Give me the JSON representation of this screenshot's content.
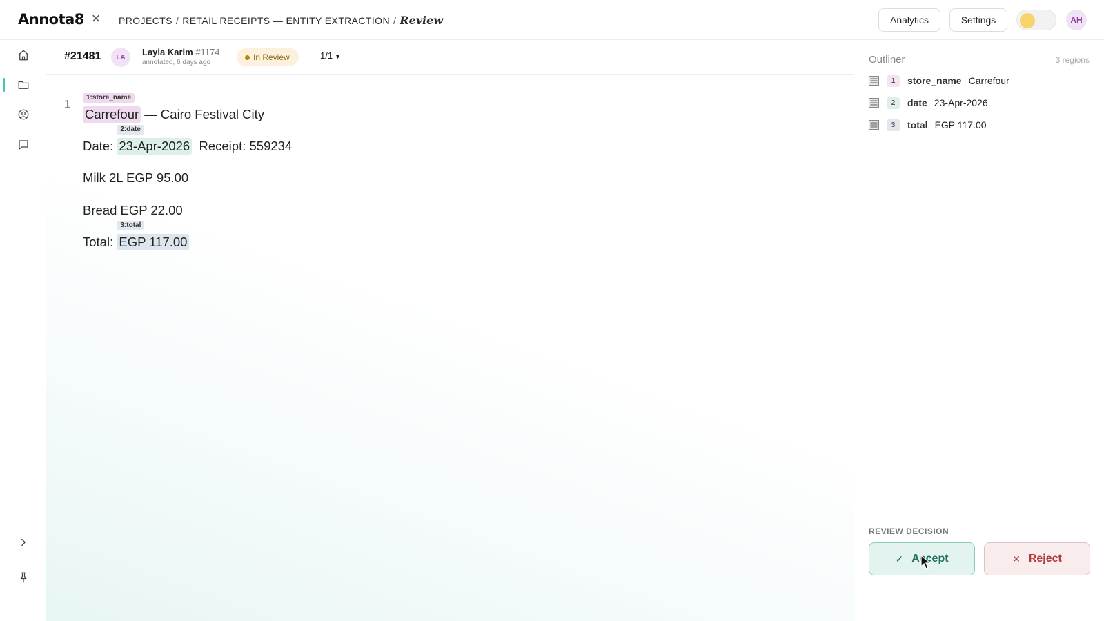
{
  "app": {
    "logo": "Annota8",
    "breadcrumb": [
      "Projects",
      "Retail Receipts — Entity Extraction"
    ],
    "breadcrumb_current": "Review"
  },
  "top_actions": {
    "analytics_label": "Analytics",
    "settings_label": "Settings",
    "user_initials": "AH"
  },
  "task": {
    "id": "#21481",
    "annotator_initials": "LA",
    "annotator_name": "Layla Karim",
    "annotator_id": "#1174",
    "annotated_time": "annotated, 6 days ago",
    "status": "In Review",
    "page_indicator": "1/1"
  },
  "document": {
    "line_number": "1",
    "lines": {
      "store": {
        "span_label": "1:store_name",
        "span_text": "Carrefour",
        "rest": " — Cairo Festival City"
      },
      "date": {
        "prefix": "Date: ",
        "span_label": "2:date",
        "span_text": "23-Apr-2026",
        "rest": "  Receipt: 559234"
      },
      "item1": "Milk 2L  EGP 95.00",
      "item2": "Bread  EGP 22.00",
      "total": {
        "prefix": "Total: ",
        "span_label": "3:total",
        "span_text": "EGP 117.00"
      }
    }
  },
  "outliner": {
    "title": "Outliner",
    "count": "3 regions",
    "regions": [
      {
        "num": "1",
        "label": "store_name",
        "value": "Carrefour"
      },
      {
        "num": "2",
        "label": "date",
        "value": "23-Apr-2026"
      },
      {
        "num": "3",
        "label": "total",
        "value": "EGP 117.00"
      }
    ]
  },
  "review": {
    "title": "Review Decision",
    "accept_label": "Accept",
    "reject_label": "Reject"
  },
  "colors": {
    "accent_teal": "#3ec7b1",
    "store_tag": "#efd9ee",
    "date_tag": "#dcefea",
    "total_tag": "#dde5ee",
    "accept": "#1f6e60",
    "reject": "#b03a3a",
    "status": "#8c6b1f"
  }
}
